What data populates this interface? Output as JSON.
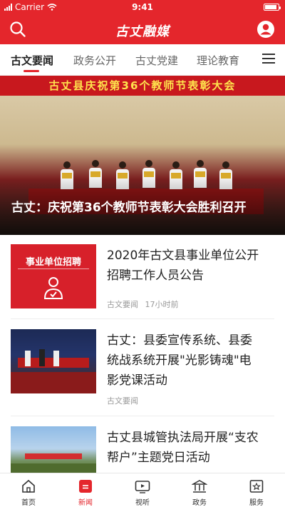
{
  "status_bar": {
    "carrier": "Carrier",
    "time": "9:41",
    "battery_level": 0.9
  },
  "header": {
    "logo_text": "古丈融媒",
    "search_icon": "search-icon",
    "user_icon": "user-icon"
  },
  "tabs": [
    {
      "label": "古文要闻",
      "active": true
    },
    {
      "label": "政务公开",
      "active": false
    },
    {
      "label": "古丈党建",
      "active": false
    },
    {
      "label": "理论教育",
      "active": false
    }
  ],
  "menu_icon": "hamburger-menu-icon",
  "hero": {
    "banner_text": "古丈县庆祝第36个教师节表彰大会",
    "caption": "古丈：庆祝第36个教师节表彰大会胜利召开"
  },
  "articles": [
    {
      "thumb_label": "事业单位招聘",
      "title_lines": [
        "2020年古文县事业单位公开",
        "招聘工作人员公告"
      ],
      "source": "古文要闻",
      "time": "17小时前"
    },
    {
      "title_lines": [
        "古丈：县委宣传系统、县委",
        "统战系统开展\"光影铸魂\"电",
        "影党课活动"
      ],
      "source": "古文要闻",
      "time": ""
    },
    {
      "title_lines": [
        "古丈县城管执法局开展“支农",
        "帮户”主题党日活动"
      ],
      "source": "",
      "time": ""
    }
  ],
  "bottom_nav": [
    {
      "label": "首页",
      "icon": "home-icon",
      "active": false
    },
    {
      "label": "新闻",
      "icon": "news-icon",
      "active": true
    },
    {
      "label": "视听",
      "icon": "video-icon",
      "active": false
    },
    {
      "label": "政务",
      "icon": "government-icon",
      "active": false
    },
    {
      "label": "服务",
      "icon": "service-icon",
      "active": false
    }
  ],
  "colors": {
    "brand_red": "#e4262c",
    "thumb_red": "#d7202a"
  }
}
